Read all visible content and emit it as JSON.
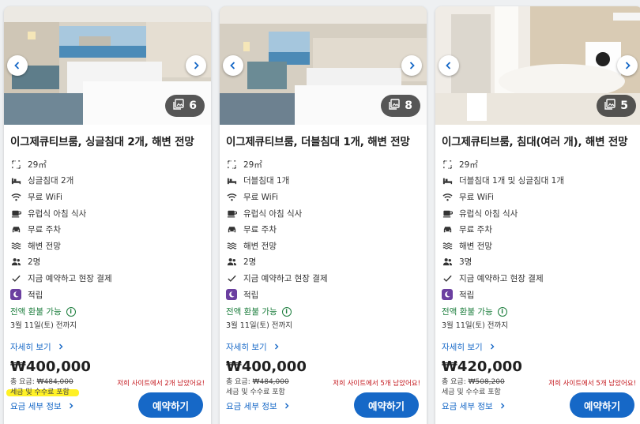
{
  "cards": [
    {
      "photo_count": "6",
      "title": "이그제큐티브룸, 싱글침대 2개, 해변 전망",
      "amenities": [
        {
          "icon": "area-icon",
          "text": "29㎡"
        },
        {
          "icon": "bed-icon",
          "text": "싱글침대 2개"
        },
        {
          "icon": "wifi-icon",
          "text": "무료 WiFi"
        },
        {
          "icon": "coffee-icon",
          "text": "유럽식 아침 식사"
        },
        {
          "icon": "car-icon",
          "text": "무료 주차"
        },
        {
          "icon": "waves-icon",
          "text": "해변 전망"
        },
        {
          "icon": "people-icon",
          "text": "2명"
        },
        {
          "icon": "check-icon",
          "text": "지금 예약하고 현장 결제"
        },
        {
          "icon": "points-icon",
          "text": "적립"
        }
      ],
      "refund": "전액 환불 가능",
      "deadline": "3월 11일(토) 전까지",
      "details": "자세히 보기",
      "price": "₩400,000",
      "total_label": "총 요금:",
      "total_value": "₩484,000",
      "fees": "세금 및 수수료 포함",
      "left_note": "저희 사이트에서 2개 남았어요!",
      "breakdown": "요금 세부 정보",
      "book": "예약하기"
    },
    {
      "photo_count": "8",
      "title": "이그제큐티브룸, 더블침대 1개, 해변 전망",
      "amenities": [
        {
          "icon": "area-icon",
          "text": "29㎡"
        },
        {
          "icon": "bed-icon",
          "text": "더블침대 1개"
        },
        {
          "icon": "wifi-icon",
          "text": "무료 WiFi"
        },
        {
          "icon": "coffee-icon",
          "text": "유럽식 아침 식사"
        },
        {
          "icon": "car-icon",
          "text": "무료 주차"
        },
        {
          "icon": "waves-icon",
          "text": "해변 전망"
        },
        {
          "icon": "people-icon",
          "text": "2명"
        },
        {
          "icon": "check-icon",
          "text": "지금 예약하고 현장 결제"
        },
        {
          "icon": "points-icon",
          "text": "적립"
        }
      ],
      "refund": "전액 환불 가능",
      "deadline": "3월 11일(토) 전까지",
      "details": "자세히 보기",
      "price": "₩400,000",
      "total_label": "총 요금:",
      "total_value": "₩484,000",
      "fees": "세금 및 수수료 포함",
      "left_note": "저희 사이트에서 5개 남았어요!",
      "breakdown": "요금 세부 정보",
      "book": "예약하기"
    },
    {
      "photo_count": "5",
      "title": "이그제큐티브룸, 침대(여러 개), 해변 전망",
      "amenities": [
        {
          "icon": "area-icon",
          "text": "29㎡"
        },
        {
          "icon": "bed-icon",
          "text": "더블침대 1개 및 싱글침대 1개"
        },
        {
          "icon": "wifi-icon",
          "text": "무료 WiFi"
        },
        {
          "icon": "coffee-icon",
          "text": "유럽식 아침 식사"
        },
        {
          "icon": "car-icon",
          "text": "무료 주차"
        },
        {
          "icon": "waves-icon",
          "text": "해변 전망"
        },
        {
          "icon": "people-icon",
          "text": "3명"
        },
        {
          "icon": "check-icon",
          "text": "지금 예약하고 현장 결제"
        },
        {
          "icon": "points-icon",
          "text": "적립"
        }
      ],
      "refund": "전액 환불 가능",
      "deadline": "3월 11일(토) 전까지",
      "details": "자세히 보기",
      "price": "₩420,000",
      "total_label": "총 요금:",
      "total_value": "₩508,200",
      "fees": "세금 및 수수료 포함",
      "left_note": "저희 사이트에서 5개 남았어요!",
      "breakdown": "요금 세부 정보",
      "book": "예약하기"
    }
  ],
  "colors": {
    "link": "#1668c7",
    "refund": "#1b7d3c",
    "alert": "#c4161c",
    "points": "#6b3fa0",
    "highlight": "#ffee00"
  }
}
